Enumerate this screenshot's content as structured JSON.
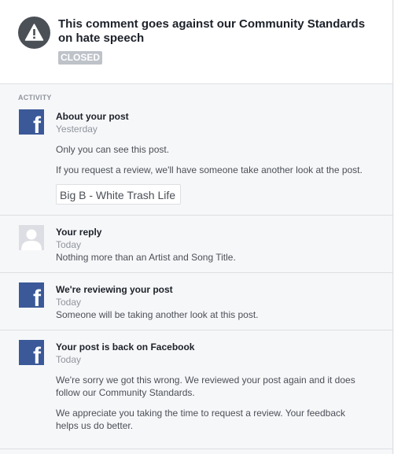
{
  "header": {
    "icon": "warning-icon",
    "title": "This comment goes against our Community Standards on hate speech",
    "status": "CLOSED"
  },
  "activity": {
    "label": "ACTIVITY",
    "entries": [
      {
        "icon": "facebook-logo-icon",
        "title": "About your post",
        "time": "Yesterday",
        "text1": "Only you can see this post.",
        "text2": "If you request a review, we'll have someone take another look at the post.",
        "post_preview": "Big B - White Trash Life"
      },
      {
        "icon": "user-avatar-icon",
        "title": "Your reply",
        "time": "Today",
        "text1": "Nothing more than an Artist and Song Title."
      },
      {
        "icon": "facebook-logo-icon",
        "title": "We're reviewing your post",
        "time": "Today",
        "text1": "Someone will be taking another look at this post."
      },
      {
        "icon": "facebook-logo-icon",
        "title": "Your post is back on Facebook",
        "time": "Today",
        "text1": "We're sorry we got this wrong. We reviewed your post again and it does follow our Community Standards.",
        "text2": "We appreciate you taking the time to request a review. Your feedback helps us do better."
      }
    ]
  },
  "colors": {
    "facebook_blue": "#3b5998",
    "warning_circle": "#4b4f56",
    "badge": "#bec2c9",
    "meta_text": "#90949c"
  }
}
